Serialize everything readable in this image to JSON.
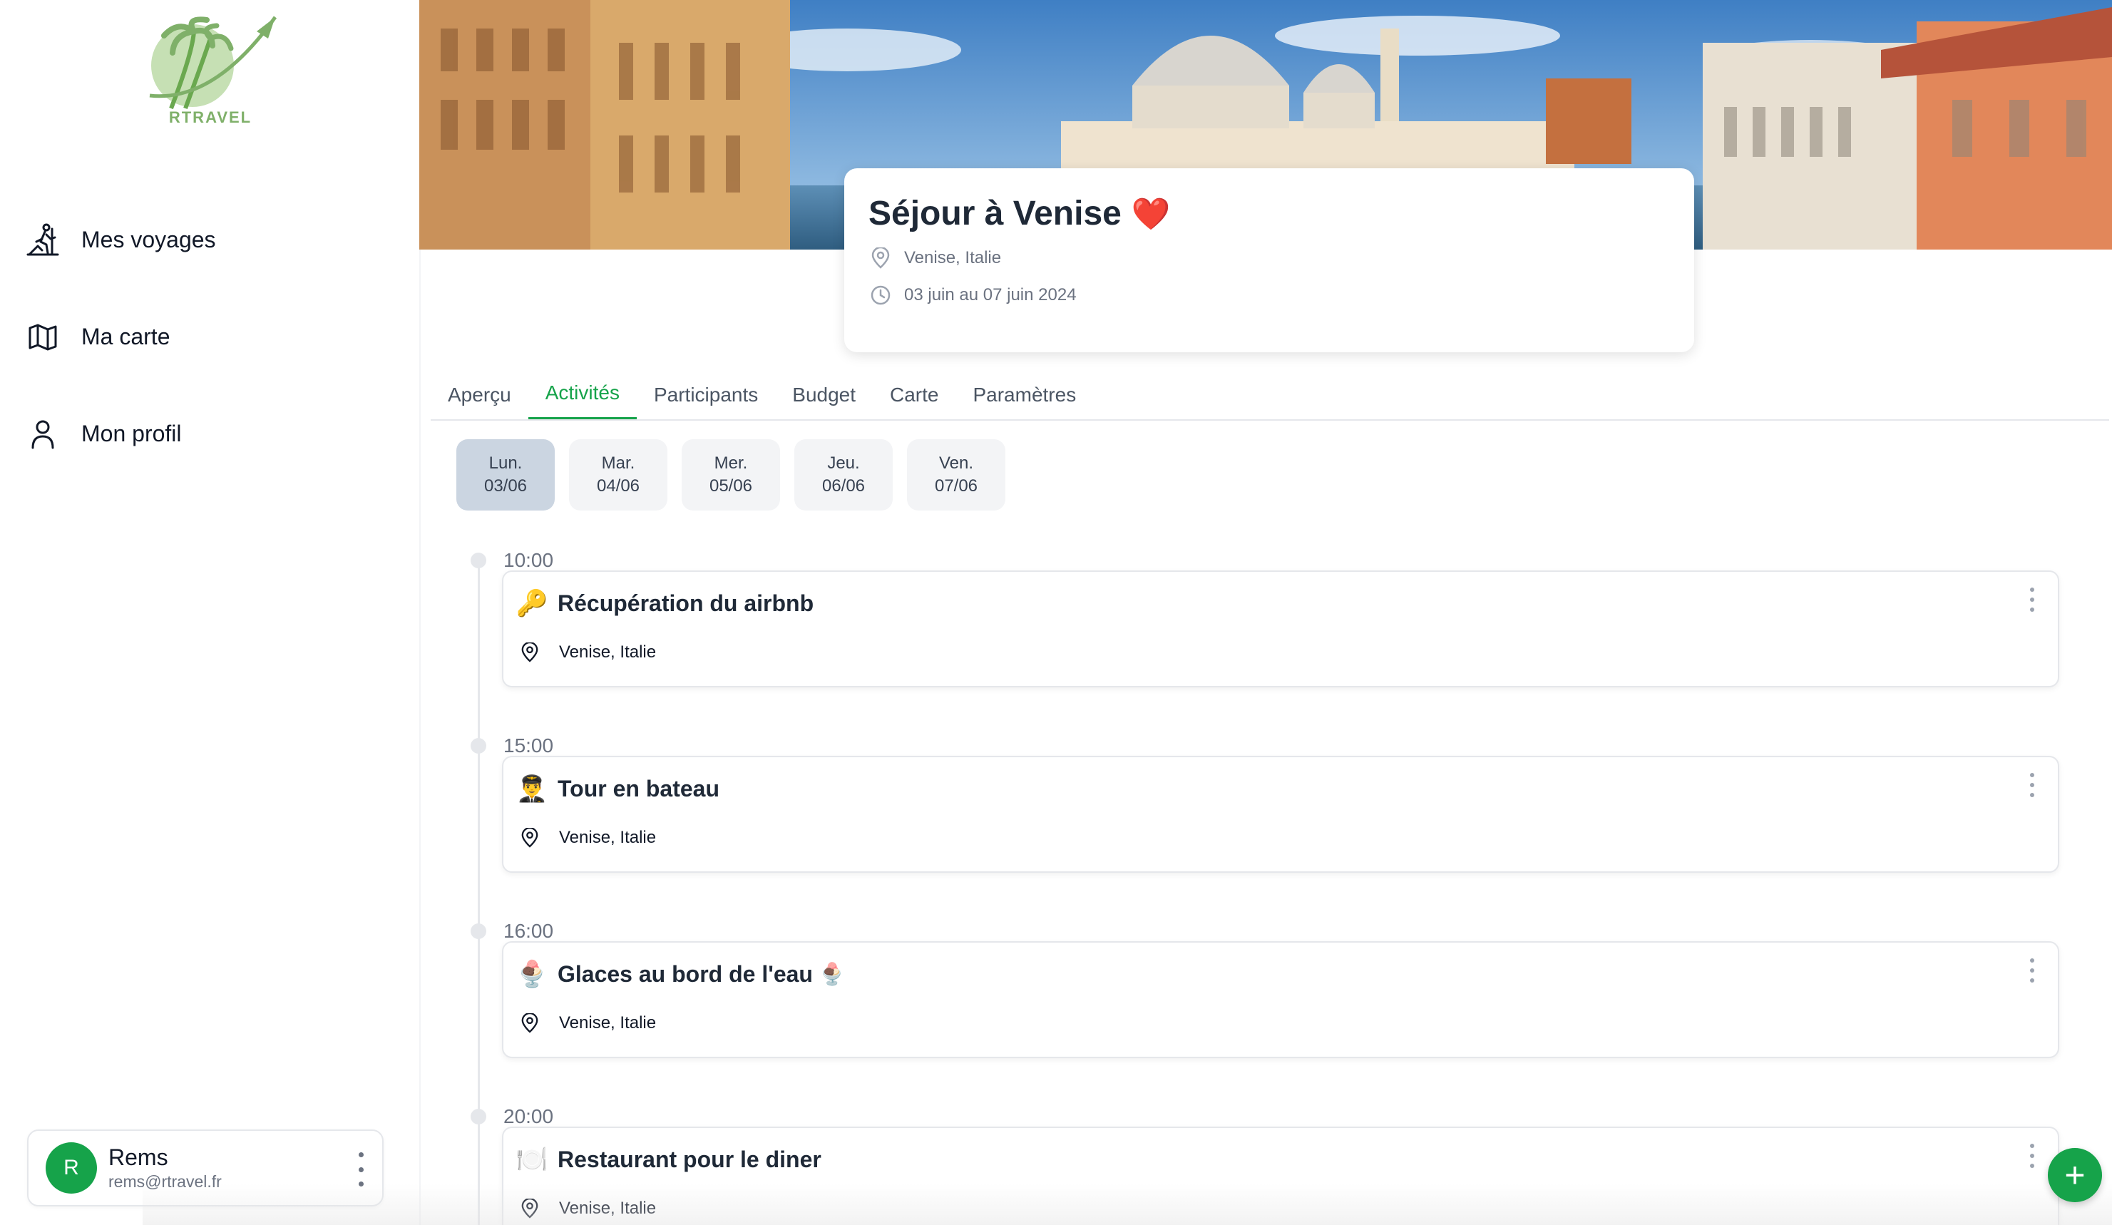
{
  "app": {
    "brand": "RTRAVEL"
  },
  "sidebar": {
    "items": [
      {
        "label": "Mes voyages",
        "icon": "hiking-icon"
      },
      {
        "label": "Ma carte",
        "icon": "map-icon"
      },
      {
        "label": "Mon profil",
        "icon": "user-icon"
      }
    ],
    "user": {
      "initial": "R",
      "name": "Rems",
      "email": "rems@rtravel.fr"
    }
  },
  "trip": {
    "title": "Séjour à Venise",
    "title_emoji": "❤️",
    "location": "Venise, Italie",
    "dates": "03 juin au 07 juin 2024"
  },
  "tabs": [
    {
      "label": "Aperçu",
      "active": false
    },
    {
      "label": "Activités",
      "active": true
    },
    {
      "label": "Participants",
      "active": false
    },
    {
      "label": "Budget",
      "active": false
    },
    {
      "label": "Carte",
      "active": false
    },
    {
      "label": "Paramètres",
      "active": false
    }
  ],
  "days": [
    {
      "day": "Lun.",
      "date": "03/06",
      "active": true
    },
    {
      "day": "Mar.",
      "date": "04/06",
      "active": false
    },
    {
      "day": "Mer.",
      "date": "05/06",
      "active": false
    },
    {
      "day": "Jeu.",
      "date": "06/06",
      "active": false
    },
    {
      "day": "Ven.",
      "date": "07/06",
      "active": false
    }
  ],
  "activities": [
    {
      "time": "10:00",
      "emoji": "🔑",
      "title": "Récupération du airbnb",
      "title_emoji": "",
      "location": "Venise, Italie"
    },
    {
      "time": "15:00",
      "emoji": "👨‍✈️",
      "title": "Tour en bateau",
      "title_emoji": "",
      "location": "Venise, Italie"
    },
    {
      "time": "16:00",
      "emoji": "🍨",
      "title": "Glaces au bord de l'eau",
      "title_emoji": "🍨",
      "location": "Venise, Italie"
    },
    {
      "time": "20:00",
      "emoji": "🍽️",
      "title": "Restaurant pour le diner",
      "title_emoji": "",
      "location": "Venise, Italie"
    }
  ],
  "fab": {
    "label": "+"
  },
  "colors": {
    "accent": "#16a34a",
    "logo": "#7fb069"
  }
}
